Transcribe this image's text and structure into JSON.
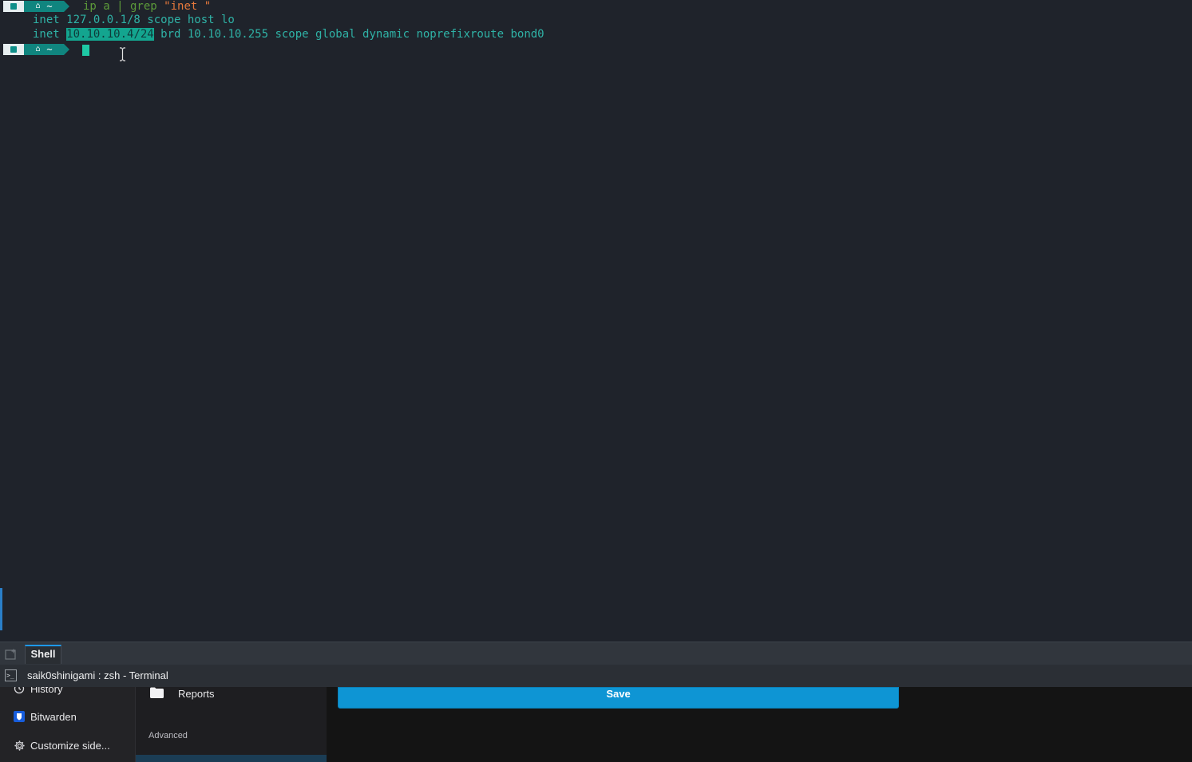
{
  "terminal": {
    "prompt_home_icon": "home-icon",
    "prompt_dir": "~",
    "command_part": "ip a | grep ",
    "command_string": "\"inet \"",
    "output_line1": "inet 127.0.0.1/8 scope host lo",
    "output_line2_prefix": "inet ",
    "output_line2_selected": "10.10.10.4/24",
    "output_line2_suffix": " brd 10.10.10.255 scope global dynamic noprefixroute bond0"
  },
  "tabbar": {
    "active_tab": "Shell"
  },
  "window": {
    "title": "saik0shinigami : zsh - Terminal"
  },
  "browser": {
    "sidebar": [
      {
        "label": "History",
        "icon": "history-icon"
      },
      {
        "label": "Bitwarden",
        "icon": "bitwarden-icon"
      },
      {
        "label": "Customize side...",
        "icon": "gear-icon"
      }
    ],
    "folder": "Reports",
    "section_label": "Advanced",
    "save_label": "Save"
  },
  "colors": {
    "terminal_bg": "#1f232b",
    "output_text": "#2fb2a6",
    "command_text": "#5c9a3a",
    "string_text": "#e5783c",
    "selection_bg": "#13a58f",
    "prompt_segment": "#10857f",
    "save_button": "#0e95d4"
  }
}
